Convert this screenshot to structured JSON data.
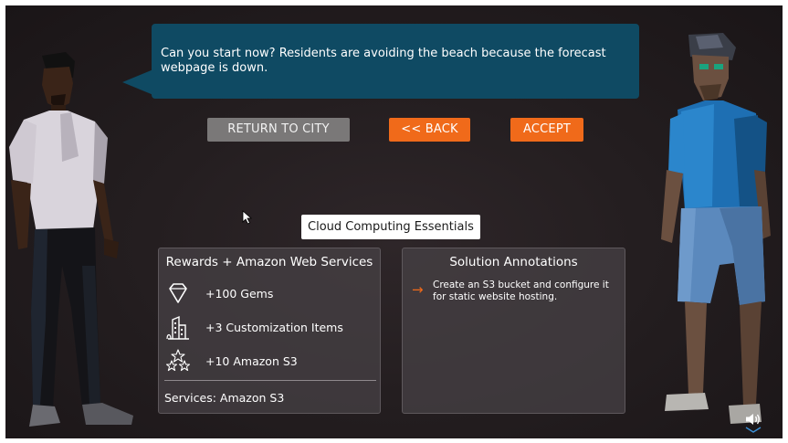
{
  "dialog": {
    "text": "Can you start now? Residents are avoiding the beach because the forecast webpage is down."
  },
  "buttons": {
    "return_label": "RETURN TO CITY",
    "back_label": "<< BACK",
    "accept_label": "ACCEPT"
  },
  "course": {
    "name": "Cloud Computing Essentials"
  },
  "rewards": {
    "title": "Rewards + Amazon Web Services",
    "items": [
      {
        "icon": "gem-icon",
        "label": "+100 Gems"
      },
      {
        "icon": "building-icon",
        "label": "+3 Customization Items"
      },
      {
        "icon": "stars-icon",
        "label": "+10 Amazon S3"
      }
    ],
    "services": "Services: Amazon S3"
  },
  "annotations": {
    "title": "Solution Annotations",
    "items": [
      {
        "icon": "arrow-right-icon",
        "text": "Create an S3 bucket and configure it for static website hosting."
      }
    ]
  },
  "colors": {
    "accent_orange": "#f06a1a",
    "bubble_blue": "#0f4a63",
    "button_gray": "#7a7878",
    "panel_bg": "#484246"
  },
  "controls": {
    "sound_icon": "speaker-icon",
    "expand_icon": "chevron-down-icon"
  }
}
